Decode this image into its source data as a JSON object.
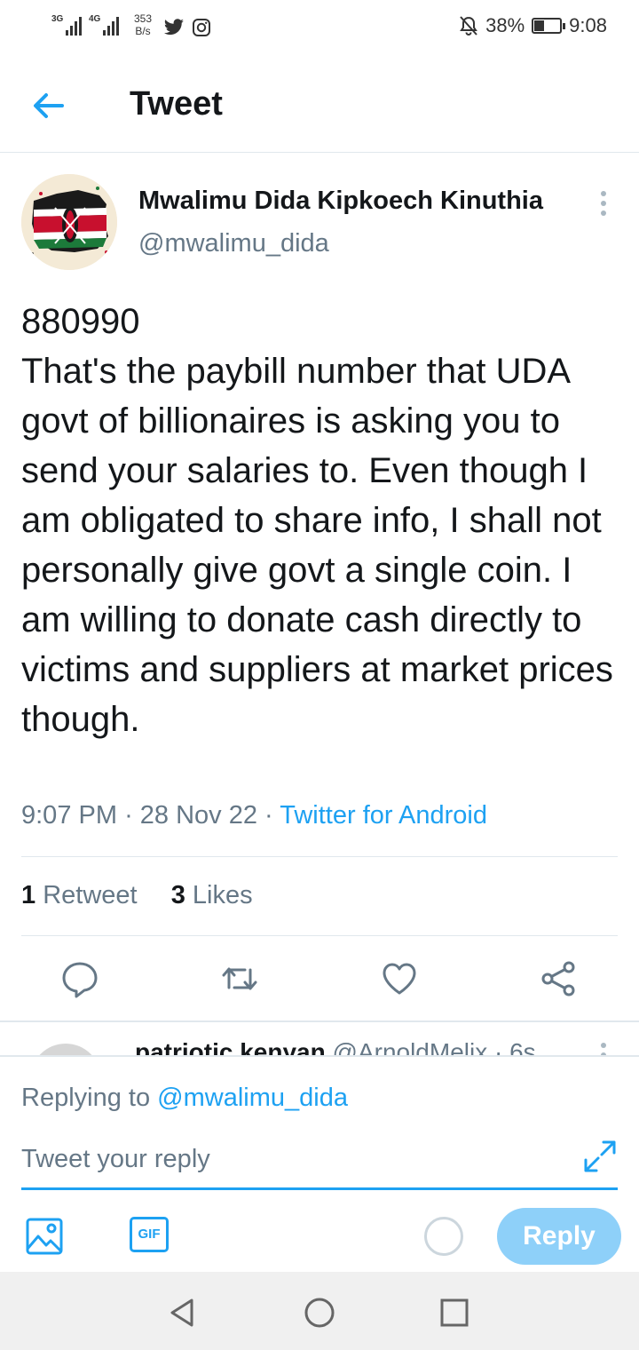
{
  "status_bar": {
    "network_1": "3G",
    "network_2": "4G",
    "speed_value": "353",
    "speed_unit": "B/s",
    "battery_percent": "38%",
    "battery_level": 0.38,
    "time": "9:08",
    "icons": [
      "signal-icon",
      "signal-icon",
      "twitter-bird-icon",
      "instagram-icon",
      "mute-bell-icon",
      "battery-icon"
    ]
  },
  "header": {
    "title": "Tweet",
    "back_icon": "arrow-left-icon"
  },
  "tweet": {
    "author_name": "Mwalimu Dida Kipkoech Kinuthia",
    "author_handle": "@mwalimu_dida",
    "text": "880990\nThat's the paybill number that UDA govt of billionaires is asking you to send your salaries to. Even though I am obligated to share info, I shall not personally give govt a single coin. I am willing to donate cash directly to victims and suppliers at market prices though.",
    "time": "9:07 PM",
    "date": "28 Nov 22",
    "source": "Twitter for Android",
    "retweet_count": "1",
    "retweet_label": "Retweet",
    "like_count": "3",
    "like_label": "Likes",
    "actions": [
      "reply-icon",
      "retweet-icon",
      "like-icon",
      "share-icon"
    ]
  },
  "next_reply": {
    "author_name": "patriotic kenyan",
    "author_handle": "@ArnoldMelix",
    "time": "6s"
  },
  "composer": {
    "replying_prefix": "Replying to",
    "replying_handle": "@mwalimu_dida",
    "placeholder": "Tweet your reply",
    "gif_label": "GIF",
    "reply_button": "Reply"
  },
  "colors": {
    "accent": "#1da1f2",
    "reply_button_disabled": "#8ed0f9",
    "secondary_text": "#657786"
  }
}
